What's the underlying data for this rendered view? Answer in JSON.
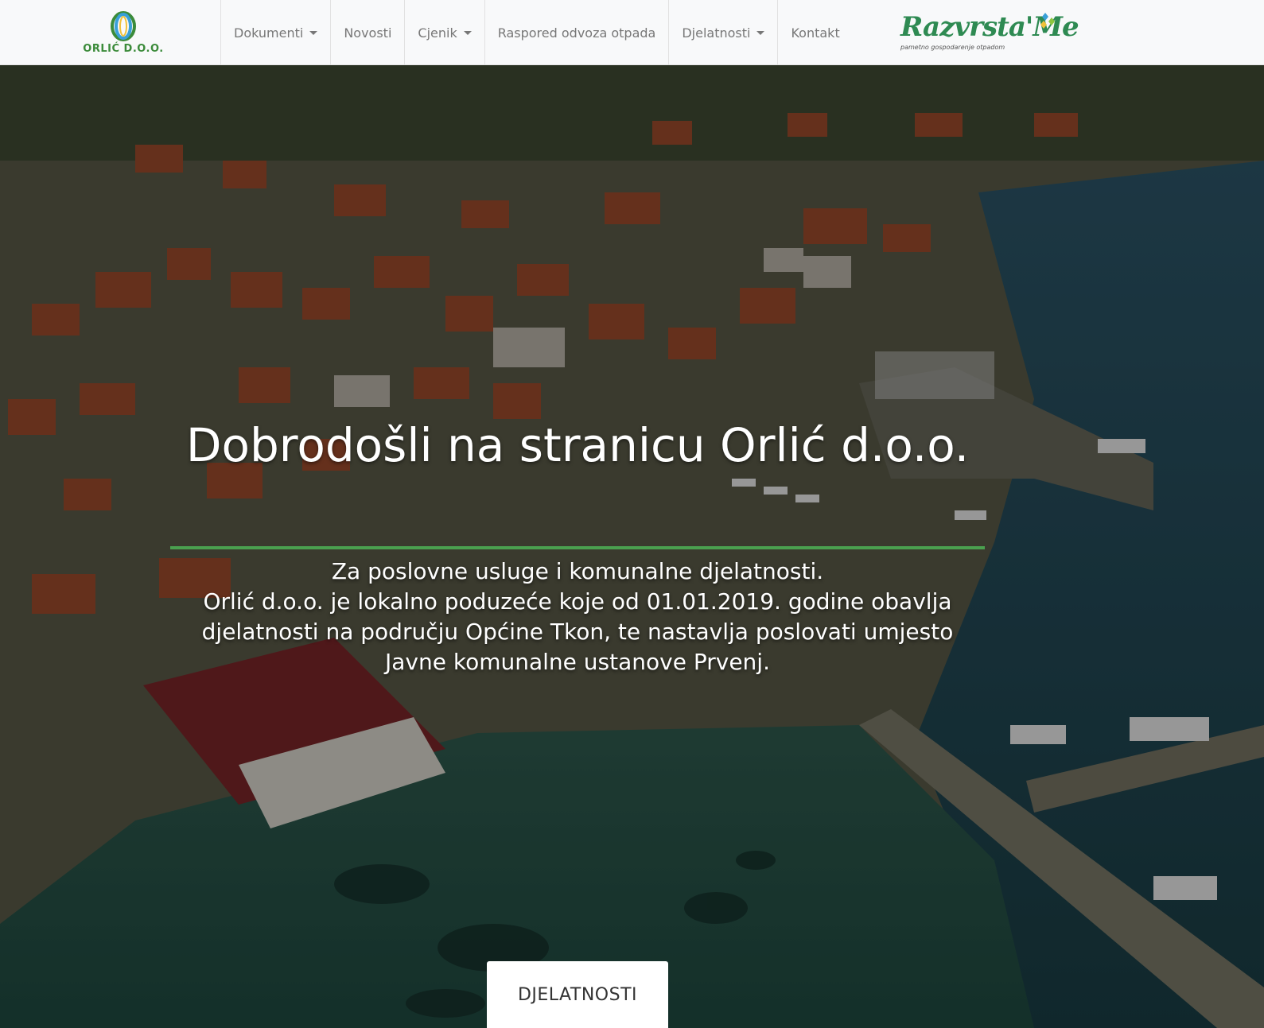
{
  "brand": {
    "name": "ORLIĆ D.O.O.",
    "icon": "orlic-logo-rings"
  },
  "nav": {
    "items": [
      {
        "label": "Dokumenti",
        "dropdown": true
      },
      {
        "label": "Novosti",
        "dropdown": false
      },
      {
        "label": "Cjenik",
        "dropdown": true
      },
      {
        "label": "Raspored odvoza otpada",
        "dropdown": false
      },
      {
        "label": "Djelatnosti",
        "dropdown": true
      },
      {
        "label": "Kontakt",
        "dropdown": false
      }
    ]
  },
  "partner_logo": {
    "title": "Razvrsta'Me",
    "subtitle": "pametno gospodarenje otpadom"
  },
  "hero": {
    "title": "Dobrodošli na stranicu Orlić d.o.o.",
    "text_line1": "Za poslovne usluge i komunalne djelatnosti.",
    "text_line2": "Orlić d.o.o. je lokalno poduzeće koje od 01.01.2019. godine obavlja djelatnosti na području Općine Tkon, te nastavlja poslovati umjesto Javne komunalne ustanove Prvenj.",
    "button_label": "DJELATNOSTI",
    "accent_color": "#4aa04f"
  },
  "colors": {
    "nav_bg": "#f8f9fa",
    "nav_text": "#777777",
    "brand_green": "#3b8b3a",
    "partner_green": "#2e8a52"
  }
}
